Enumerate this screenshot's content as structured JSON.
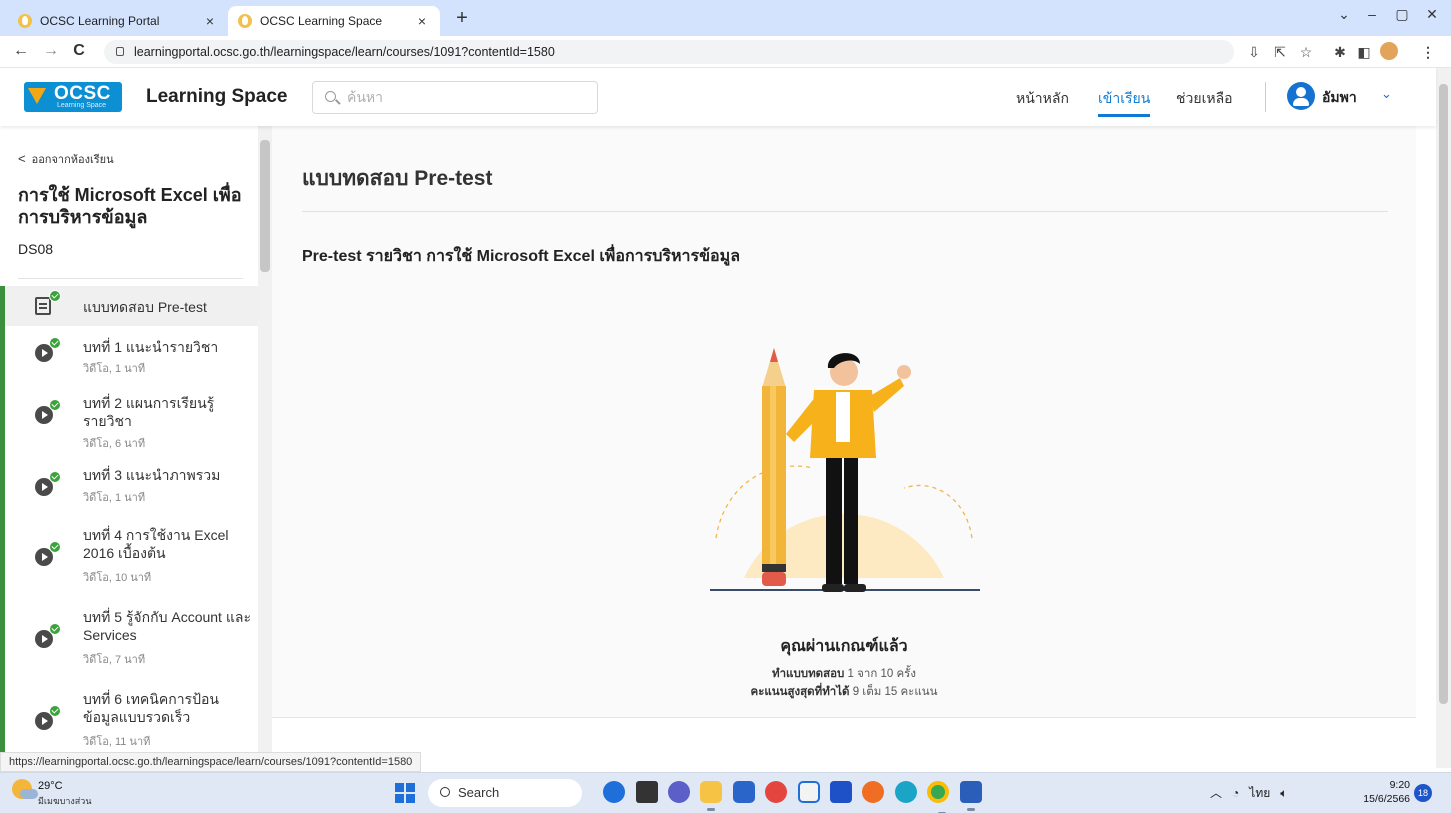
{
  "browser": {
    "tabs": [
      {
        "title": "OCSC Learning Portal",
        "close": "×"
      },
      {
        "title": "OCSC Learning Space",
        "close": "×"
      }
    ],
    "new_tab": "+",
    "window_controls": [
      "⌄",
      "–",
      "▢",
      "✕"
    ],
    "nav": {
      "back": "←",
      "forward": "→",
      "reload": "C"
    },
    "url": "learningportal.ocsc.go.th/learningspace/learn/courses/1091?contentId=1580",
    "status_url": "https://learningportal.ocsc.go.th/learningspace/learn/courses/1091?contentId=1580"
  },
  "site": {
    "logo_word": "OCSC",
    "logo_sub": "Learning Space",
    "brand": "Learning Space",
    "search_placeholder": "ค้นหา",
    "nav": [
      "หน้าหลัก",
      "เข้าเรียน",
      "ช่วยเหลือ"
    ],
    "nav_active": 1,
    "user_name": "อัมพา",
    "accent_color": "#0e7ad3"
  },
  "sidebar": {
    "back_label": "ออกจากห้องเรียน",
    "course_title": "การใช้ Microsoft Excel เพื่อการบริหารข้อมูล",
    "course_code": "DS08",
    "lessons": [
      {
        "title": "แบบทดสอบ Pre-test",
        "meta": "",
        "icon": "quiz-icon"
      },
      {
        "title": "บทที่ 1 แนะนำรายวิชา",
        "meta": "วิดีโอ, 1 นาที",
        "icon": "play-icon"
      },
      {
        "title": "บทที่ 2 แผนการเรียนรู้รายวิชา",
        "meta": "วิดีโอ, 6 นาที",
        "icon": "play-icon"
      },
      {
        "title": "บทที่ 3 แนะนำภาพรวม",
        "meta": "วิดีโอ, 1 นาที",
        "icon": "play-icon"
      },
      {
        "title": "บทที่ 4 การใช้งาน Excel 2016 เบื้องต้น",
        "meta": "วิดีโอ, 10 นาที",
        "icon": "play-icon"
      },
      {
        "title": "บทที่ 5 รู้จักกับ Account และ Services",
        "meta": "วิดีโอ, 7 นาที",
        "icon": "play-icon"
      },
      {
        "title": "บทที่ 6 เทคนิคการป้อนข้อมูลแบบรวดเร็ว",
        "meta": "วิดีโอ, 11 นาที",
        "icon": "play-icon"
      }
    ],
    "complete_color": "#3c8f3c"
  },
  "main": {
    "title": "แบบทดสอบ Pre-test",
    "subtitle": "Pre-test รายวิชา การใช้ Microsoft Excel เพื่อการบริหารข้อมูล",
    "result_heading": "คุณผ่านเกณฑ์แล้ว",
    "attempts_label": "ทำแบบทดสอบ",
    "attempts_value": "1 จาก 10 ครั้ง",
    "score_label": "คะแนนสูงสุดที่ทำได้",
    "score_value": "9 เต็ม 15 คะแนน"
  },
  "taskbar": {
    "temperature": "29°C",
    "weather_desc": "มีเมฆบางส่วน",
    "search_label": "Search",
    "tray_lang": "ไทย",
    "time": "9:20",
    "date": "15/6/2566",
    "notifications": "18"
  }
}
